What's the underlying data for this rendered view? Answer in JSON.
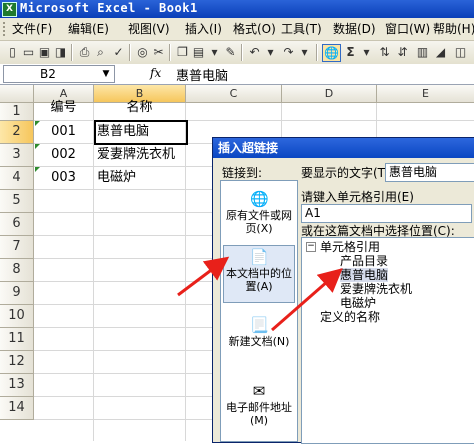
{
  "window": {
    "title": "Microsoft Excel - Book1"
  },
  "menu": {
    "items": [
      "文件(F)",
      "编辑(E)",
      "视图(V)",
      "插入(I)",
      "格式(O)",
      "工具(T)",
      "数据(D)",
      "窗口(W)",
      "帮助(H)"
    ]
  },
  "toolbar": {
    "autosum_label": "Σ"
  },
  "formula_bar": {
    "name_box": "B2",
    "fx_label": "fx",
    "formula": "惠普电脑"
  },
  "columns": [
    "A",
    "B",
    "C",
    "D",
    "E"
  ],
  "rows": [
    "1",
    "2",
    "3",
    "4",
    "5",
    "6",
    "7",
    "8",
    "9",
    "10",
    "11",
    "12",
    "13",
    "14"
  ],
  "cells": {
    "a1": "编号",
    "b1": "名称",
    "a2": "001",
    "b2": "惠普电脑",
    "a3": "002",
    "b3": "爱妻牌洗衣机",
    "a4": "003",
    "b4": "电磁炉"
  },
  "dialog": {
    "title": "插入超链接",
    "link_to_label": "链接到:",
    "link_options": [
      "原有文件或网页(X)",
      "本文档中的位置(A)",
      "新建文档(N)",
      "电子邮件地址(M)"
    ],
    "display_text_label": "要显示的文字(T):",
    "display_text_value": "惠普电脑",
    "cell_ref_label": "请键入单元格引用(E)",
    "cell_ref_value": "A1",
    "select_place_label": "或在这篇文档中选择位置(C):",
    "tree": {
      "root": "单元格引用",
      "items": [
        "产品目录",
        "惠普电脑",
        "爱妻牌洗衣机",
        "电磁炉"
      ],
      "defined_names": "定义的名称"
    }
  },
  "colors": {
    "annotation_arrow": "#e8201a",
    "title_bar": "#0a46c2",
    "selected_header": "#f6c65c"
  }
}
